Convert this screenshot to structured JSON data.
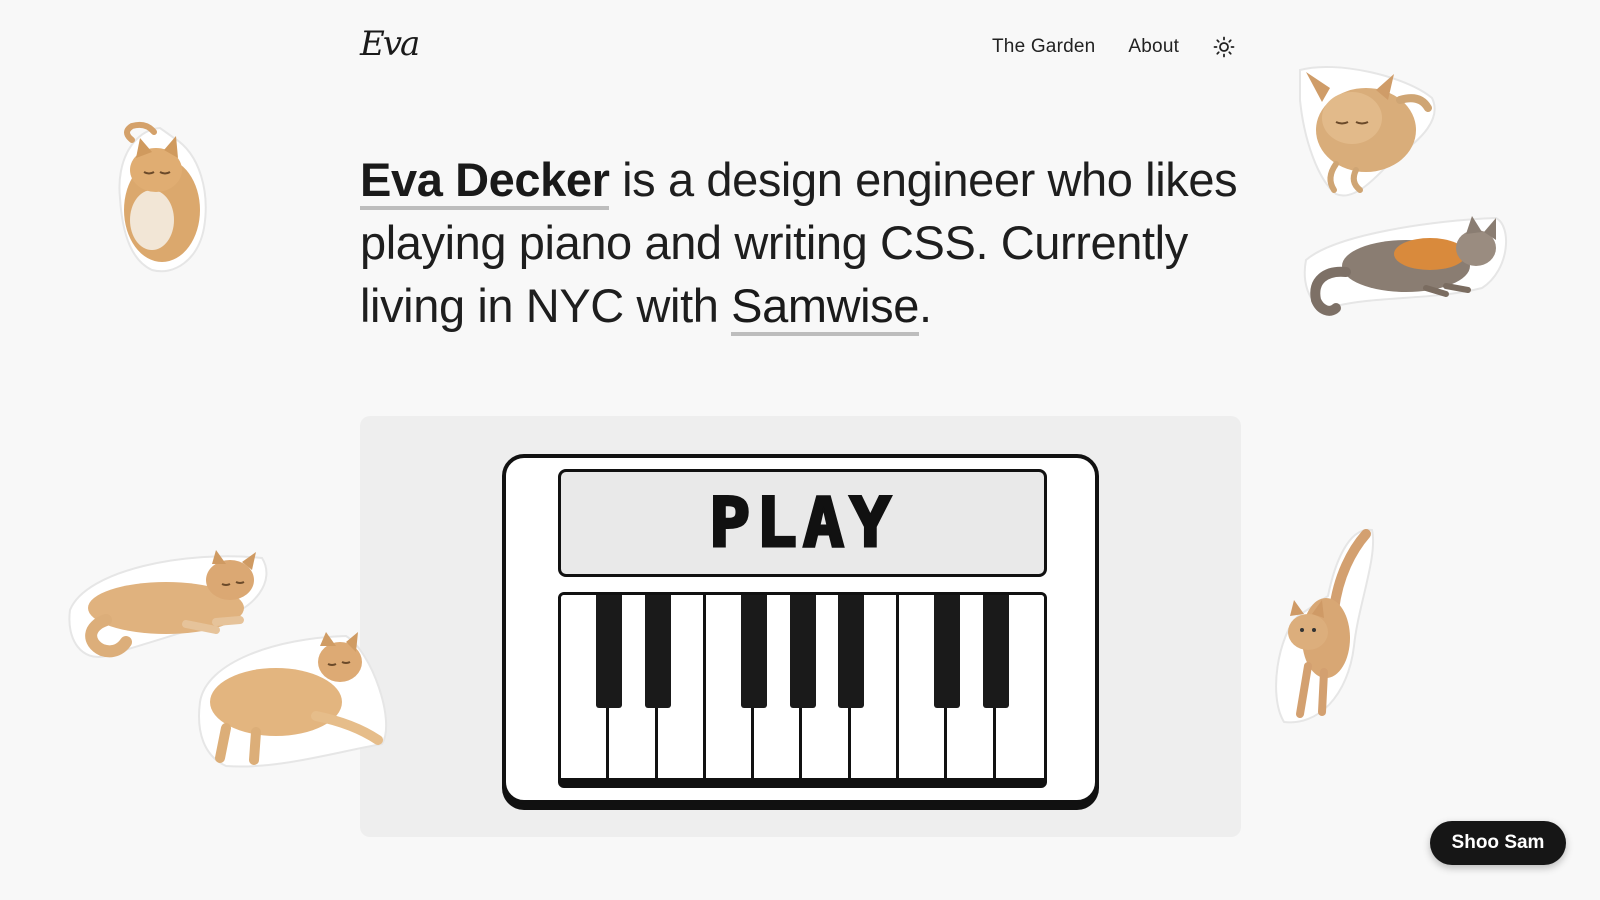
{
  "header": {
    "logo": "Eva",
    "nav": [
      {
        "label": "The Garden"
      },
      {
        "label": "About"
      }
    ],
    "theme_icon": "sun-icon"
  },
  "hero": {
    "name": "Eva Decker",
    "text_1": " is a design engineer who likes playing piano and writing CSS. Currently living in NYC with ",
    "cat_name": "Samwise",
    "text_2": "."
  },
  "piano": {
    "display_label": "PLAY",
    "white_keys": 10,
    "black_key_positions": [
      1,
      2,
      4,
      5,
      6,
      8,
      9
    ]
  },
  "shoo_button": {
    "label": "Shoo Sam"
  },
  "colors": {
    "background": "#f8f8f8",
    "card": "#eeeeee",
    "ink": "#111111",
    "cat_orange": "#d9a56a",
    "cat_shadow": "#b87d44"
  }
}
